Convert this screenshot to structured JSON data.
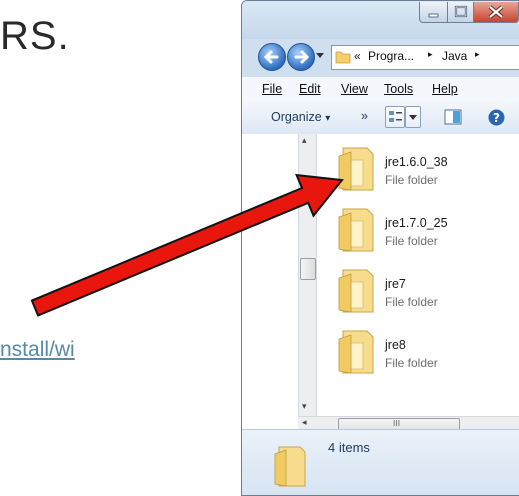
{
  "slide": {
    "heading_fragment": "RS.",
    "link_fragment": "nstall/wi"
  },
  "window": {
    "address": {
      "overflow": "«",
      "crumb1": "Progra...",
      "sep": "▸",
      "crumb2": "Java",
      "sep2": "▸"
    },
    "menu": {
      "file": "File",
      "edit": "Edit",
      "view": "View",
      "tools": "Tools",
      "help": "Help"
    },
    "toolbar": {
      "organize": "Organize",
      "more": "»",
      "dropdown": "▾"
    },
    "items": [
      {
        "name": "jre1.6.0_38",
        "type": "File folder"
      },
      {
        "name": "jre1.7.0_25",
        "type": "File folder"
      },
      {
        "name": "jre7",
        "type": "File folder"
      },
      {
        "name": "jre8",
        "type": "File folder"
      }
    ],
    "details": {
      "count": "4 items"
    },
    "scroll": {
      "up": "▴",
      "down": "▾",
      "left": "◂",
      "grip": "III"
    }
  },
  "colors": {
    "arrow": "#e8160c",
    "folder": "#f4cf6b",
    "window_frame": "#cfdff0"
  }
}
